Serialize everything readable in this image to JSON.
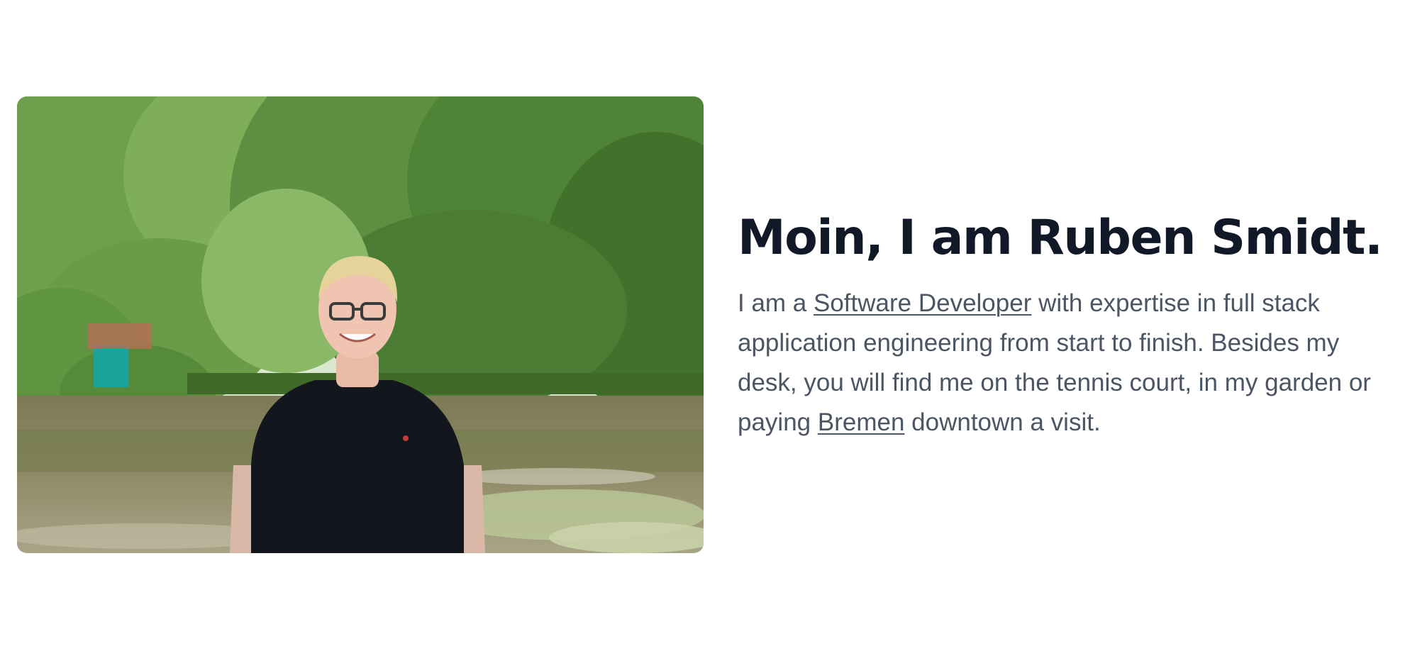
{
  "hero": {
    "photo_alt": "Ruben Smidt standing in front of a pond surrounded by trees"
  },
  "intro": {
    "heading": "Moin, I am Ruben Smidt.",
    "text_1": "I am a ",
    "role_link": "Software Developer",
    "text_2": " with expertise in full stack application engineering from start to finish. Besides my desk, you will find me on the tennis court, in my garden or paying ",
    "city_link": "Bremen",
    "text_3": " downtown a visit."
  },
  "colors": {
    "heading": "#111827",
    "body": "#4b5563",
    "background": "#ffffff"
  }
}
